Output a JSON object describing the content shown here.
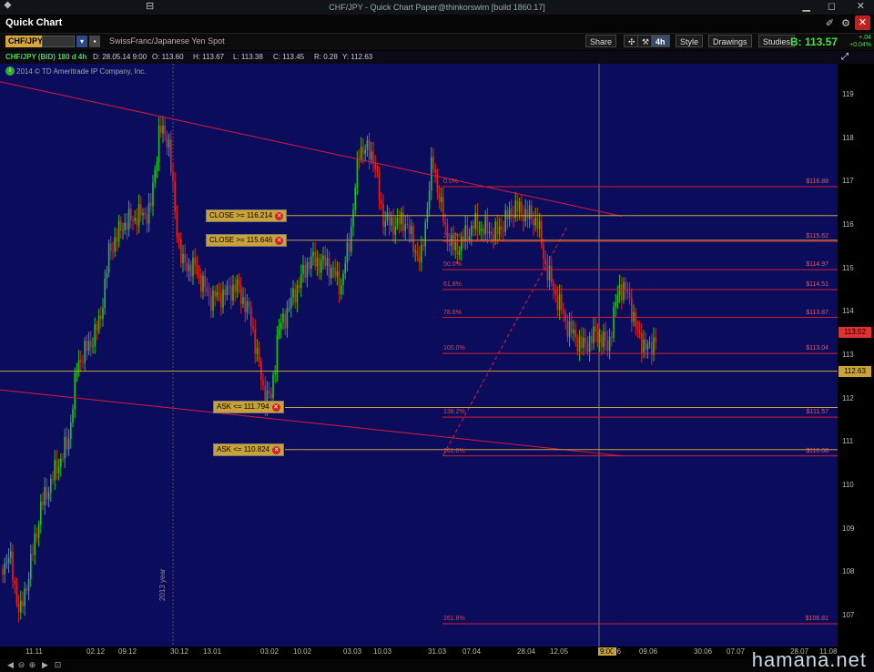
{
  "window": {
    "title": "CHF/JPY - Quick Chart Paper@thinkorswim [build 1860.17]"
  },
  "header": {
    "title": "Quick Chart"
  },
  "toolbar": {
    "symbol": "CHF/JPY",
    "description": "SwissFranc/Japanese Yen Spot",
    "share": "Share",
    "aggregation": "4h",
    "style": "Style",
    "drawings": "Drawings",
    "studies": "Studies",
    "last_label": "B: 113.57",
    "change_abs": "+.04",
    "change_pct": "+0.04%"
  },
  "infobar": {
    "symbol": "CHF/JPY (BID) 180 d 4h",
    "date": "D: 28.05.14 9:00",
    "open": "O: 113.60",
    "high": "H: 113.67",
    "low": "L: 113.38",
    "close": "C: 113.45",
    "range": "R: 0.28",
    "y": "Y: 112.63"
  },
  "copyright": "2014 © TD Ameritrade IP Company, Inc.",
  "orders": [
    {
      "label": "CLOSE >= 116.214",
      "price": 116.214
    },
    {
      "label": "CLOSE >= 115.646",
      "price": 115.646
    },
    {
      "label": "ASK <= 111.794",
      "price": 111.794
    },
    {
      "label": "ASK <= 110.824",
      "price": 110.824
    }
  ],
  "fib": [
    {
      "pct": "0.0%",
      "value": "$116.88"
    },
    {
      "pct": "23.6%",
      "value": "$115.62"
    },
    {
      "pct": "50.0%",
      "value": "$114.97"
    },
    {
      "pct": "61.8%",
      "value": "$114.51"
    },
    {
      "pct": "78.6%",
      "value": "$113.87"
    },
    {
      "pct": "100.0%",
      "value": "$113.04"
    },
    {
      "pct": "138.2%",
      "value": "$111.57"
    },
    {
      "pct": "161.8%",
      "value": "$110.68"
    },
    {
      "pct": "261.8%",
      "value": "$106.81"
    }
  ],
  "price_flags": [
    {
      "text": "113.52",
      "color": "#e03030",
      "price": 113.52
    },
    {
      "text": "112.63",
      "color": "#c9a338",
      "price": 112.63
    }
  ],
  "yaxis_ticks": [
    "119",
    "118",
    "117",
    "116",
    "115",
    "114",
    "113",
    "112",
    "111",
    "110",
    "109",
    "108",
    "107"
  ],
  "xaxis_ticks": [
    "11.11",
    "02.12",
    "09.12",
    "30.12",
    "13.01",
    "03.02",
    "10.02",
    "03.03",
    "10.03",
    "31.03",
    "07.04",
    "28.04",
    "12.05",
    "9:00",
    "06",
    "09.06",
    "30.06",
    "07.07",
    "28.07",
    "11.08"
  ],
  "year_marker": "2013 year",
  "watermark": "hamana.net",
  "colors": {
    "chart_bg": "#0c0c5c",
    "up": "#22c322",
    "down": "#e02323",
    "trend": "#d81b3c",
    "order_line": "#c9a338",
    "fib": "#d0202c"
  }
}
